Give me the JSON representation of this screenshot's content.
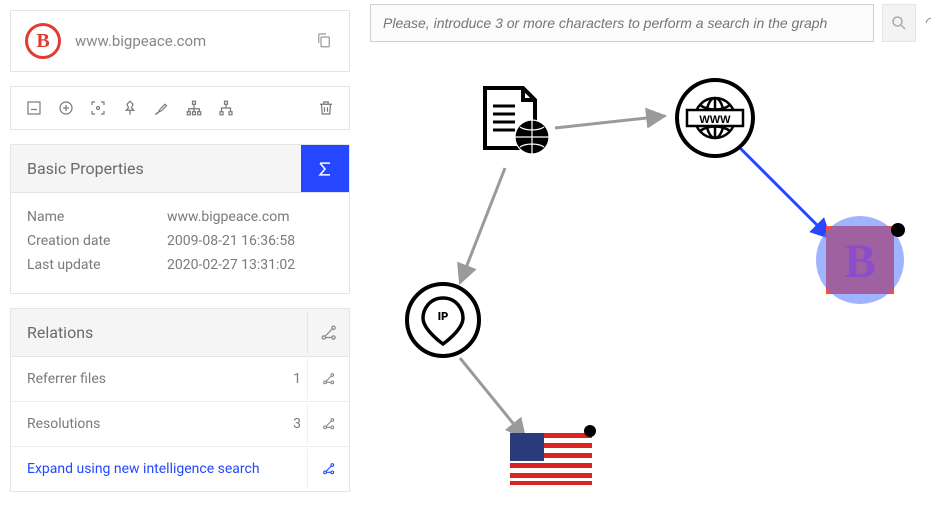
{
  "header": {
    "logo_letter": "B",
    "site": "www.bigpeace.com"
  },
  "search": {
    "placeholder": "Please, introduce 3 or more characters to perform a search in the graph"
  },
  "basic_properties": {
    "title": "Basic Properties",
    "rows": [
      {
        "k": "Name",
        "v": "www.bigpeace.com"
      },
      {
        "k": "Creation date",
        "v": "2009-08-21 16:36:58"
      },
      {
        "k": "Last update",
        "v": "2020-02-27 13:31:02"
      }
    ]
  },
  "relations": {
    "title": "Relations",
    "rows": [
      {
        "label": "Referrer files",
        "count": "1"
      },
      {
        "label": "Resolutions",
        "count": "3"
      }
    ],
    "expand_label": "Expand using new intelligence search"
  },
  "graph_nodes": {
    "file": "file-webpage",
    "www": "www",
    "ip": "ip-location",
    "flag": "us-flag",
    "logo": "site-logo"
  }
}
